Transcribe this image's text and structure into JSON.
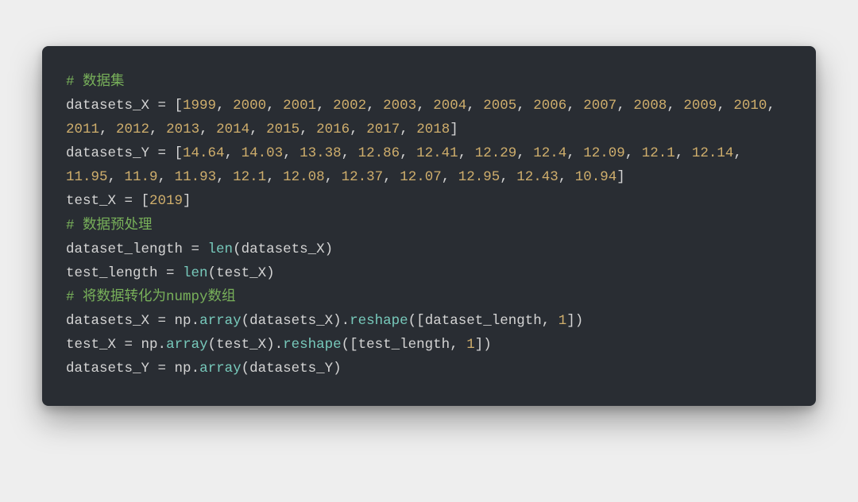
{
  "code": {
    "lines": [
      {
        "type": "comment",
        "text": "# 数据集"
      },
      {
        "type": "assign_list_int",
        "lhs": "datasets_X",
        "values": [
          1999,
          2000,
          2001,
          2002,
          2003,
          2004,
          2005,
          2006,
          2007,
          2008,
          2009,
          2010,
          2011,
          2012,
          2013,
          2014,
          2015,
          2016,
          2017,
          2018
        ]
      },
      {
        "type": "assign_list_float",
        "lhs": "datasets_Y",
        "values": [
          "14.64",
          "14.03",
          "13.38",
          "12.86",
          "12.41",
          "12.29",
          "12.4",
          "12.09",
          "12.1",
          "12.14",
          "11.95",
          "11.9",
          "11.93",
          "12.1",
          "12.08",
          "12.37",
          "12.07",
          "12.95",
          "12.43",
          "10.94"
        ]
      },
      {
        "type": "assign_list_int",
        "lhs": "test_X",
        "values": [
          2019
        ]
      },
      {
        "type": "blank"
      },
      {
        "type": "comment",
        "text": "# 数据预处理"
      },
      {
        "type": "assign_len",
        "lhs": "dataset_length",
        "fn": "len",
        "arg": "datasets_X"
      },
      {
        "type": "assign_len",
        "lhs": "test_length",
        "fn": "len",
        "arg": "test_X"
      },
      {
        "type": "comment",
        "text": "# 将数据转化为numpy数组"
      },
      {
        "type": "np_reshape",
        "lhs": "datasets_X",
        "module": "np",
        "fn1": "array",
        "arg1": "datasets_X",
        "fn2": "reshape",
        "dim0": "dataset_length",
        "dim1": 1
      },
      {
        "type": "np_reshape",
        "lhs": "test_X",
        "module": "np",
        "fn1": "array",
        "arg1": "test_X",
        "fn2": "reshape",
        "dim0": "test_length",
        "dim1": 1
      },
      {
        "type": "np_array",
        "lhs": "datasets_Y",
        "module": "np",
        "fn1": "array",
        "arg1": "datasets_Y"
      }
    ]
  }
}
